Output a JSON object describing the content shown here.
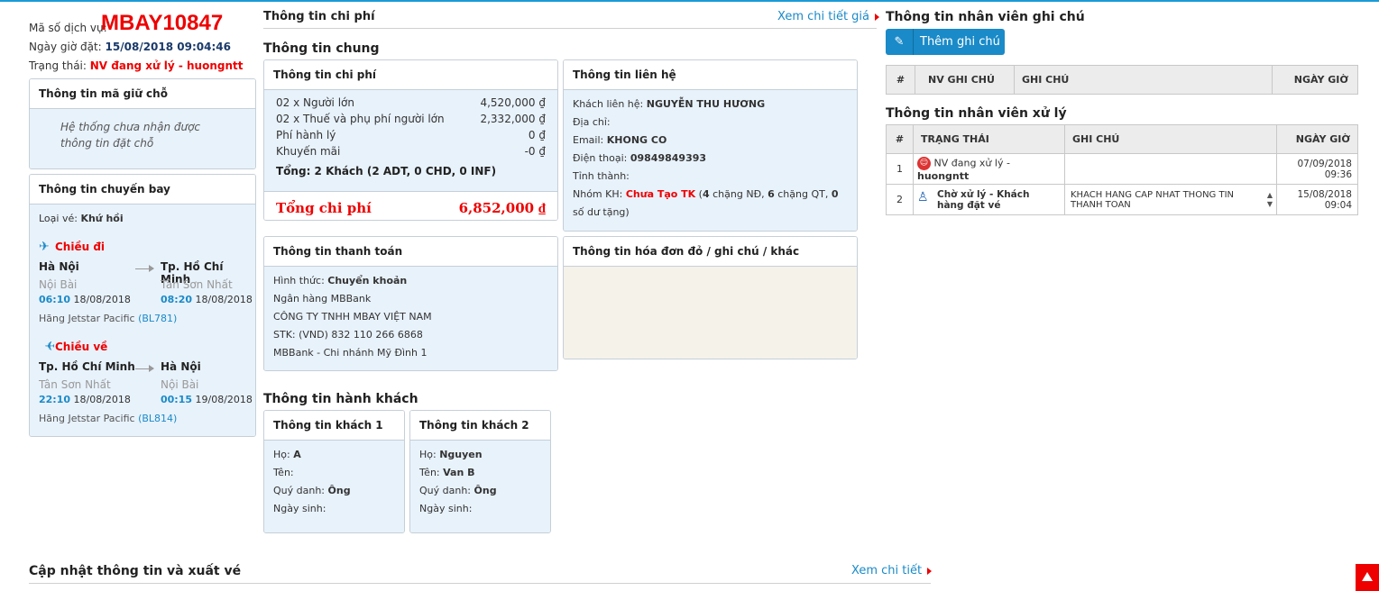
{
  "header": {
    "service_code_label": "Mã số dịch vụ:",
    "service_code": "MBAY10847",
    "booking_time_label": "Ngày giờ đặt:",
    "booking_time": "15/08/2018 09:04:46",
    "status_label": "Trạng thái:",
    "status_value": "NV đang xử lý - huongntt"
  },
  "reservation": {
    "title": "Thông tin mã giữ chỗ",
    "message": "Hệ thống chưa nhận được thông tin đặt chỗ"
  },
  "flight": {
    "title": "Thông tin chuyến bay",
    "ticket_type_label": "Loại vé:",
    "ticket_type": "Khứ hồi",
    "outbound": {
      "label": "Chiều đi",
      "from_city": "Hà Nội",
      "to_city": "Tp. Hồ Chí Minh",
      "from_airport": "Nội Bài",
      "to_airport": "Tân Sơn Nhất",
      "dep_time": "06:10",
      "dep_date": "18/08/2018",
      "arr_time": "08:20",
      "arr_date": "18/08/2018",
      "airline_text": "Hãng Jetstar Pacific",
      "flight_no": "(BL781)"
    },
    "inbound": {
      "label": "Chiều về",
      "from_city": "Tp. Hồ Chí Minh",
      "to_city": "Hà Nội",
      "from_airport": "Tân Sơn Nhất",
      "to_airport": "Nội Bài",
      "dep_time": "22:10",
      "dep_date": "18/08/2018",
      "arr_time": "00:15",
      "arr_date": "19/08/2018",
      "airline_text": "Hãng Jetstar Pacific",
      "flight_no": "(BL814)"
    }
  },
  "cost_section": {
    "title": "Thông tin chi phí",
    "view_price_link": "Xem chi tiết giá",
    "general_title": "Thông tin chung"
  },
  "cost_panel": {
    "title": "Thông tin chi phí",
    "rows": [
      {
        "label": "02 x Người lớn",
        "value": "4,520,000 ₫"
      },
      {
        "label": "02 x Thuế và phụ phí người lớn",
        "value": "2,332,000 ₫"
      },
      {
        "label": "Phí hành lý",
        "value": "0 ₫"
      },
      {
        "label": "Khuyến mãi",
        "value": "-0 ₫"
      }
    ],
    "total_guests": "Tổng: 2 Khách (2 ADT, 0 CHD, 0 INF)",
    "total_label": "Tổng chi phí",
    "total_value": "6,852,000 ₫"
  },
  "contact_panel": {
    "title": "Thông tin liên hệ",
    "contact_label": "Khách liên hệ:",
    "contact_name": "NGUYỄN THU HƯƠNG",
    "address_label": "Địa chỉ:",
    "email_label": "Email:",
    "email": "KHONG CO",
    "phone_label": "Điện thoại:",
    "phone": "09849849393",
    "province_label": "Tỉnh thành:",
    "group_label": "Nhóm KH:",
    "group_value": "Chưa Tạo TK",
    "group_paren_open": "(",
    "nd_count": "4",
    "nd_text": "chặng NĐ,",
    "qt_count": "6",
    "qt_text": "chặng QT,",
    "debt_count": "0",
    "debt_text": "số dư tặng)"
  },
  "payment_panel": {
    "title": "Thông tin thanh toán",
    "method_label": "Hình thức:",
    "method": "Chuyển khoản",
    "bank_line": "Ngân hàng MBBank",
    "company_line": "CÔNG TY TNHH MBAY VIỆT NAM",
    "account_line": "STK: (VND) 832 110 266 6868",
    "branch_line": "MBBank - Chi nhánh Mỹ Đình 1"
  },
  "invoice_panel": {
    "title": "Thông tin hóa đơn đỏ / ghi chú / khác"
  },
  "passengers": {
    "title": "Thông tin hành khách",
    "items": [
      {
        "title": "Thông tin khách 1",
        "last_label": "Họ:",
        "last": "A",
        "first_label": "Tên:",
        "first": "",
        "salutation_label": "Quý danh:",
        "salutation": "Ông",
        "dob_label": "Ngày sinh:",
        "dob": ""
      },
      {
        "title": "Thông tin khách 2",
        "last_label": "Họ:",
        "last": "Nguyen",
        "first_label": "Tên:",
        "first": "Van B",
        "salutation_label": "Quý danh:",
        "salutation": "Ông",
        "dob_label": "Ngày sinh:",
        "dob": ""
      }
    ]
  },
  "notes": {
    "title": "Thông tin nhân viên ghi chú",
    "add_button": "Thêm ghi chú",
    "columns": [
      "#",
      "NV GHI CHÚ",
      "GHI CHÚ",
      "NGÀY GIỜ"
    ]
  },
  "handling": {
    "title": "Thông tin nhân viên xử lý",
    "columns": [
      "#",
      "TRẠNG THÁI",
      "GHI CHÚ",
      "NGÀY GIỜ"
    ],
    "rows": [
      {
        "num": "1",
        "status": "NV đang xử lý -",
        "staff": "huongntt",
        "note": "",
        "date": "07/09/2018",
        "time": "09:36"
      },
      {
        "num": "2",
        "status": "Chờ xử lý - Khách hàng đặt vé",
        "staff": "",
        "note": "KHACH HANG CAP NHAT THONG TIN THANH TOAN",
        "date": "15/08/2018",
        "time": "09:04"
      }
    ]
  },
  "update": {
    "title": "Cập nhật thông tin và xuất vé",
    "view_link": "Xem chi tiết"
  },
  "colors": {
    "accent": "#1a8ac8",
    "danger": "#e00000",
    "panel_bg": "#e8f2fb"
  }
}
